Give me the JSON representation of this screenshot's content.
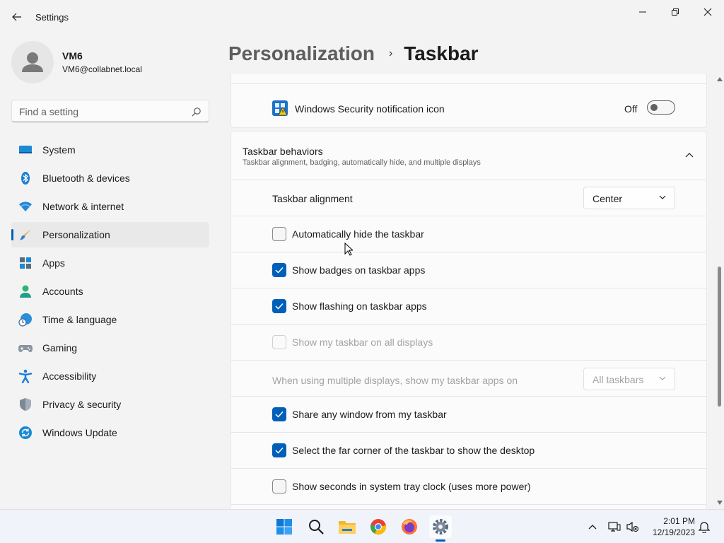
{
  "window": {
    "title": "Settings"
  },
  "profile": {
    "name": "VM6",
    "email": "VM6@collabnet.local"
  },
  "search": {
    "placeholder": "Find a setting"
  },
  "nav": {
    "items": [
      {
        "label": "System",
        "icon": "system-icon"
      },
      {
        "label": "Bluetooth & devices",
        "icon": "bluetooth-icon"
      },
      {
        "label": "Network & internet",
        "icon": "wifi-icon"
      },
      {
        "label": "Personalization",
        "icon": "brush-icon",
        "active": true
      },
      {
        "label": "Apps",
        "icon": "apps-icon"
      },
      {
        "label": "Accounts",
        "icon": "accounts-icon"
      },
      {
        "label": "Time & language",
        "icon": "time-language-icon"
      },
      {
        "label": "Gaming",
        "icon": "gamepad-icon"
      },
      {
        "label": "Accessibility",
        "icon": "accessibility-icon"
      },
      {
        "label": "Privacy & security",
        "icon": "shield-icon"
      },
      {
        "label": "Windows Update",
        "icon": "update-icon"
      }
    ]
  },
  "breadcrumb": {
    "parent": "Personalization",
    "separator": "›",
    "current": "Taskbar"
  },
  "security_row": {
    "label": "Windows Security notification icon",
    "toggle_state": "Off"
  },
  "behaviors": {
    "title": "Taskbar behaviors",
    "subtitle": "Taskbar alignment, badging, automatically hide, and multiple displays",
    "alignment": {
      "label": "Taskbar alignment",
      "value": "Center"
    },
    "options": [
      {
        "label": "Automatically hide the taskbar",
        "checked": false,
        "disabled": false
      },
      {
        "label": "Show badges on taskbar apps",
        "checked": true,
        "disabled": false
      },
      {
        "label": "Show flashing on taskbar apps",
        "checked": true,
        "disabled": false
      },
      {
        "label": "Show my taskbar on all displays",
        "checked": false,
        "disabled": true
      }
    ],
    "multi_display": {
      "label": "When using multiple displays, show my taskbar apps on",
      "value": "All taskbars"
    },
    "options2": [
      {
        "label": "Share any window from my taskbar",
        "checked": true
      },
      {
        "label": "Select the far corner of the taskbar to show the desktop",
        "checked": true
      },
      {
        "label": "Show seconds in system tray clock (uses more power)",
        "checked": false
      }
    ]
  },
  "taskbar": {
    "time": "2:01 PM",
    "date": "12/19/2023"
  },
  "colors": {
    "accent": "#005fb8",
    "background": "#f3f3f3",
    "card": "#fbfbfb"
  }
}
